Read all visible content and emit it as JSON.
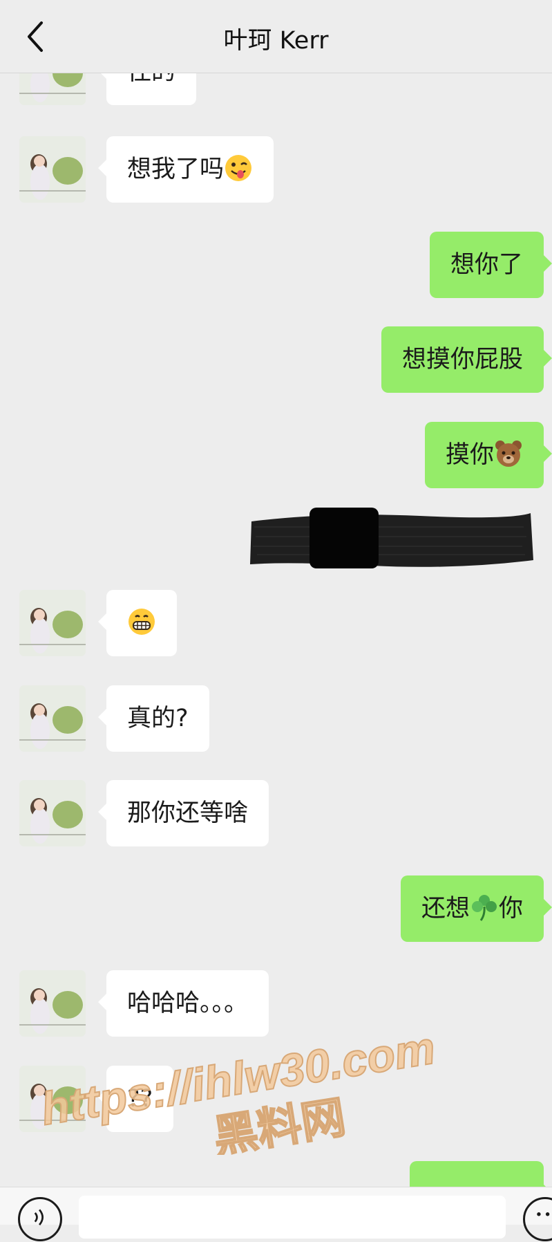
{
  "header": {
    "title": "叶珂 Kerr"
  },
  "messages": [
    {
      "side": "left",
      "text": "往的"
    },
    {
      "side": "left",
      "text": "想我了吗",
      "emoji": "winking-tongue-emoji"
    },
    {
      "side": "right",
      "text": "想你了"
    },
    {
      "side": "right",
      "text": "想摸你屁股"
    },
    {
      "side": "right",
      "text": "摸你",
      "emoji": "bear-face-emoji"
    },
    {
      "side": "right",
      "redacted": true
    },
    {
      "side": "left",
      "emoji": "grinning-face-emoji"
    },
    {
      "side": "left",
      "text": "真的?"
    },
    {
      "side": "left",
      "text": "那你还等啥"
    },
    {
      "side": "right",
      "text_before": "还想",
      "emoji": "shamrock-emoji",
      "text_after": "你"
    },
    {
      "side": "left",
      "text": "哈哈哈。。。"
    },
    {
      "side": "left",
      "text": "??"
    },
    {
      "side": "right",
      "text": ""
    }
  ],
  "watermark": {
    "line1": "https://ihlw30.com",
    "line2": "黑料网"
  },
  "colors": {
    "background": "#ededed",
    "self_bubble": "#95ec69",
    "other_bubble": "#ffffff"
  },
  "input": {
    "value": ""
  }
}
